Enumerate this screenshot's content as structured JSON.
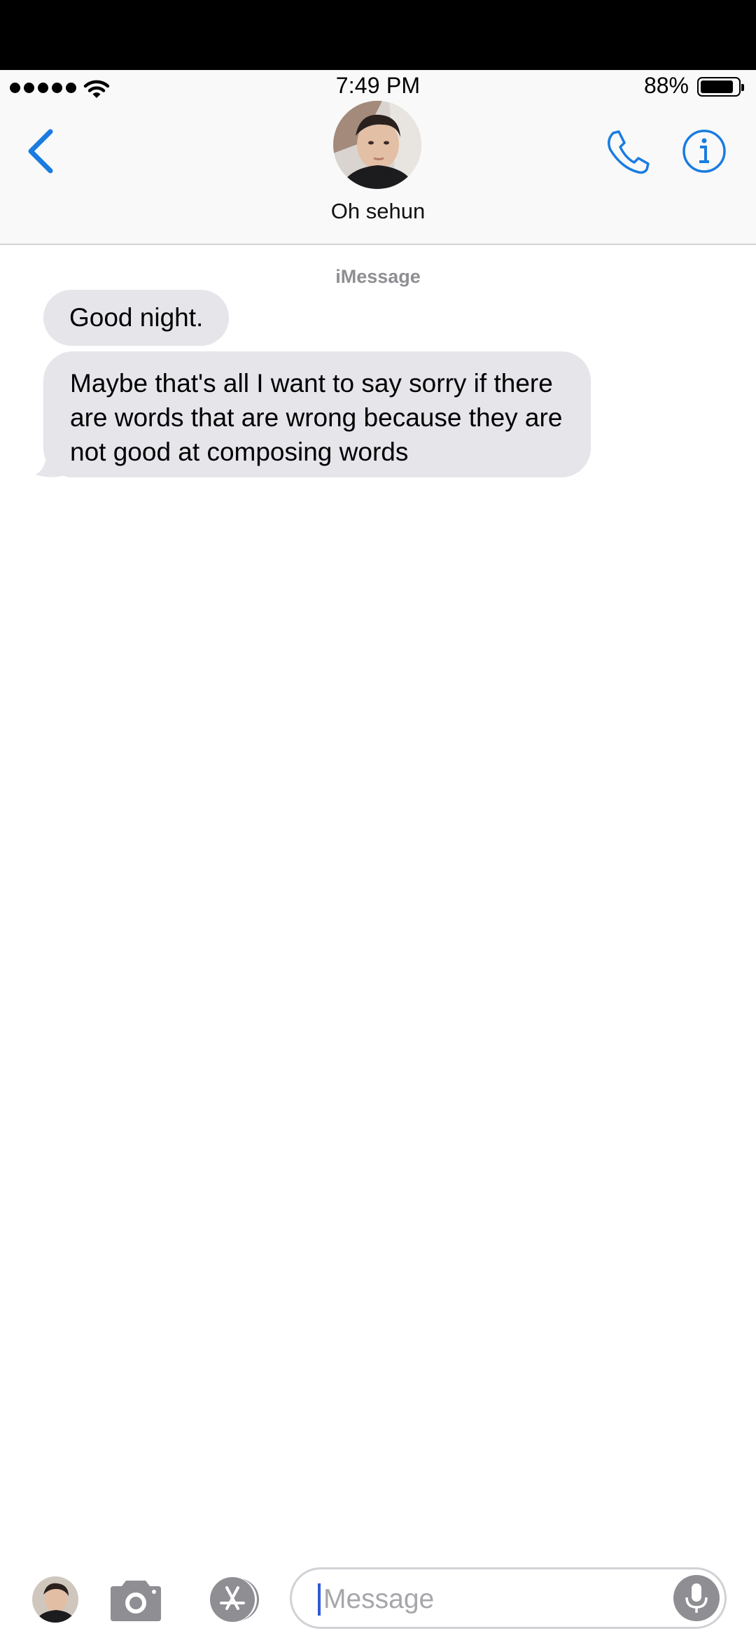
{
  "status_bar": {
    "time": "7:49 PM",
    "battery_percent_label": "88%",
    "battery_level": 0.88,
    "signal_bars": 5,
    "wifi_icon": "wifi-icon"
  },
  "header": {
    "contact_name": "Oh sehun",
    "back_icon": "chevron-left-icon",
    "call_icon": "phone-icon",
    "info_icon": "info-icon"
  },
  "conversation": {
    "service_label": "iMessage",
    "messages": [
      {
        "direction": "incoming",
        "text": "Good night."
      },
      {
        "direction": "incoming",
        "text": "Maybe that's all I want to say sorry if there are words that are wrong because they are not good at composing words"
      }
    ]
  },
  "input_bar": {
    "placeholder": "Message",
    "camera_icon": "camera-icon",
    "apps_icon": "app-store-icon",
    "mic_icon": "microphone-icon"
  },
  "colors": {
    "accent": "#1a7ce0",
    "bubble_incoming": "#e5e5ea",
    "secondary_text": "#8e8e93",
    "background": "#ffffff"
  }
}
